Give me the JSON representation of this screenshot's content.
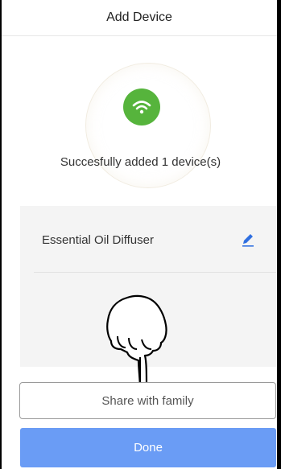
{
  "header": {
    "title": "Add Device"
  },
  "status": {
    "icon": "wifi-icon",
    "message": "Succesfully added 1 device(s)"
  },
  "device": {
    "name": "Essential Oil Diffuser",
    "edit_icon": "pencil-icon"
  },
  "actions": {
    "share_label": "Share with family",
    "done_label": "Done"
  },
  "colors": {
    "success": "#56b43c",
    "primary": "#6a9cf5",
    "accent": "#2f6fe0"
  }
}
